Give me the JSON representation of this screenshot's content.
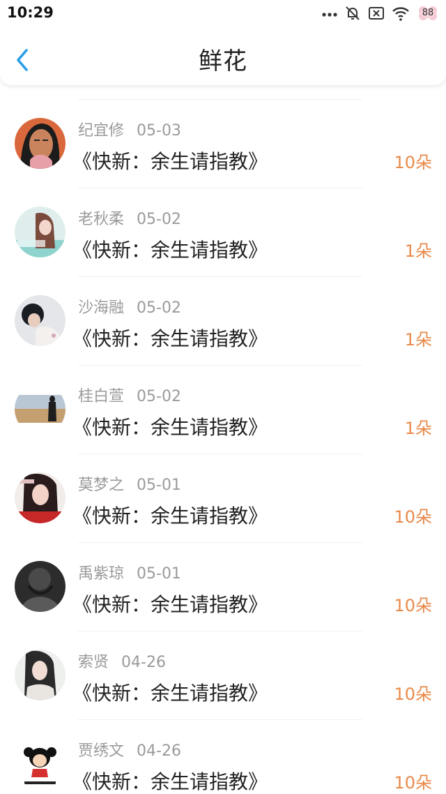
{
  "status_bar": {
    "time": "10:29",
    "icons": [
      "more-dots-icon",
      "mute-bell-icon",
      "sim-x-icon",
      "wifi-icon",
      "battery-icon"
    ],
    "battery": "88"
  },
  "header": {
    "title": "鲜花",
    "back_icon": "chevron-left-icon",
    "accent_color": "#2a9de8"
  },
  "colors": {
    "amount": "#e98a4a",
    "meta": "#9a9a9a"
  },
  "gifts": [
    {
      "user": "纪宜修",
      "date": "05-03",
      "book": "《快新：余生请指教》",
      "amount": "10朵",
      "avatar": "avatar-illustrated-woman"
    },
    {
      "user": "老秋柔",
      "date": "05-02",
      "book": "《快新：余生请指教》",
      "amount": "1朵",
      "avatar": "avatar-girl-photo"
    },
    {
      "user": "沙海融",
      "date": "05-02",
      "book": "《快新：余生请指教》",
      "amount": "1朵",
      "avatar": "avatar-couple-photo"
    },
    {
      "user": "桂白萱",
      "date": "05-02",
      "book": "《快新：余生请指教》",
      "amount": "1朵",
      "avatar": "avatar-beach-silhouette"
    },
    {
      "user": "莫梦之",
      "date": "05-01",
      "book": "《快新：余生请指教》",
      "amount": "10朵",
      "avatar": "avatar-red-girl"
    },
    {
      "user": "禹紫琼",
      "date": "05-01",
      "book": "《快新：余生请指教》",
      "amount": "10朵",
      "avatar": "avatar-dark-figure"
    },
    {
      "user": "索贤",
      "date": "04-26",
      "book": "《快新：余生请指教》",
      "amount": "10朵",
      "avatar": "avatar-ancient-costume"
    },
    {
      "user": "贾绣文",
      "date": "04-26",
      "book": "《快新：余生请指教》",
      "amount": "10朵",
      "avatar": "avatar-cartoon-girl"
    }
  ]
}
